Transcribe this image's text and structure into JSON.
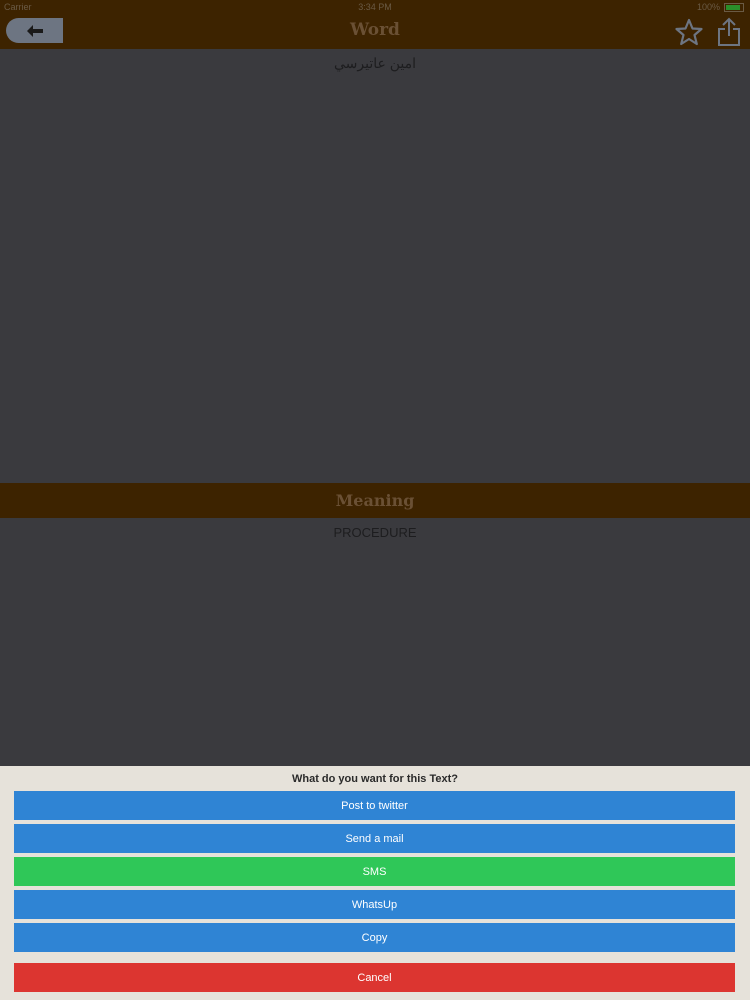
{
  "status_bar": {
    "carrier": "Carrier",
    "time": "3:34 PM",
    "battery": "100%"
  },
  "nav": {
    "title": "Word"
  },
  "word": {
    "text": "امين عاتيرسي"
  },
  "meaning": {
    "header": "Meaning",
    "text": "PROCEDURE"
  },
  "action_sheet": {
    "title": "What do you want for this Text?",
    "post_twitter": "Post to twitter",
    "send_mail": "Send a mail",
    "sms": "SMS",
    "whatsup": "WhatsUp",
    "copy": "Copy",
    "cancel": "Cancel"
  },
  "colors": {
    "nav_bg": "#3d2300",
    "button_blue": "#2f84d4",
    "button_green": "#2fc758",
    "button_red": "#dc3530",
    "sheet_bg": "#e6e2da"
  }
}
